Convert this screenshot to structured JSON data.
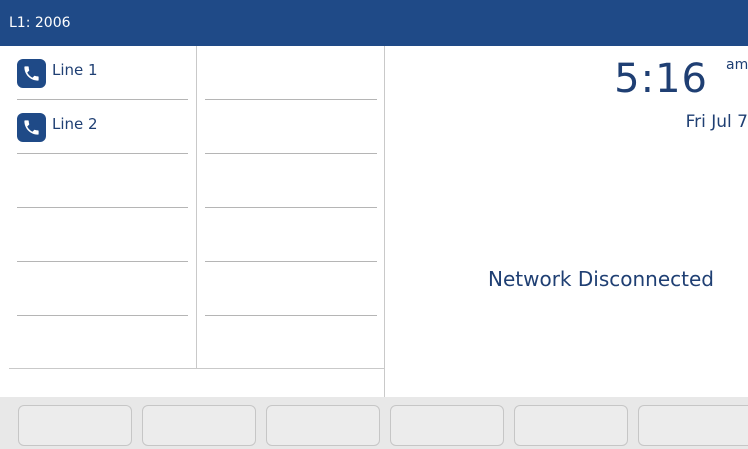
{
  "header": {
    "title": "L1: 2006"
  },
  "line_keys": {
    "col1": [
      {
        "label": "Line 1",
        "icon": "phone-icon"
      },
      {
        "label": "Line 2",
        "icon": "phone-icon"
      },
      {
        "label": ""
      },
      {
        "label": ""
      },
      {
        "label": ""
      }
    ],
    "col2": [
      {
        "label": ""
      },
      {
        "label": ""
      },
      {
        "label": ""
      },
      {
        "label": ""
      },
      {
        "label": ""
      }
    ]
  },
  "clock": {
    "time": "5:16",
    "ampm": "am",
    "date": "Fri Jul 7"
  },
  "status": {
    "message": "Network Disconnected"
  },
  "softkeys": [
    "",
    "",
    "",
    "",
    "",
    ""
  ],
  "colors": {
    "header_bg": "#1f4a87",
    "text": "#1f3f73",
    "softkey_bar": "#e8e8e8"
  }
}
